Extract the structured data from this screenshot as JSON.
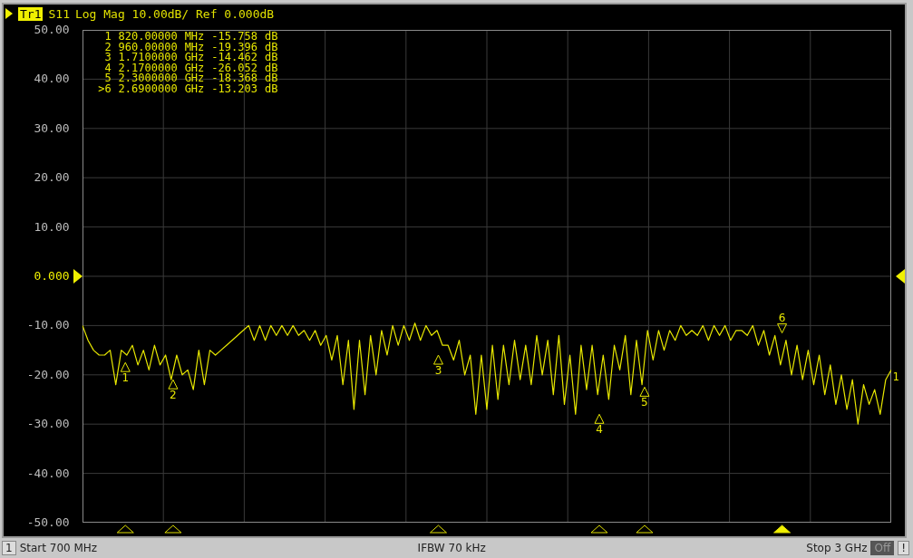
{
  "trace": {
    "tag": "Tr1",
    "title": "Log Mag 10.00dB/ Ref 0.000dB",
    "end_label": "1"
  },
  "plot": {
    "y_ticks": [
      {
        "reference": false
      },
      {
        "reference": false
      },
      {
        "reference": false
      },
      {
        "reference": false
      },
      {
        "reference": false
      },
      {
        "reference": true
      },
      {
        "reference": false
      },
      {
        "reference": false
      },
      {
        "reference": false
      },
      {
        "reference": false
      },
      {
        "reference": false
      }
    ],
    "chart_data": {
      "type": "line",
      "ylim": [
        -50,
        50
      ],
      "yticks": [
        {
          "value": 50,
          "label": "50.00"
        },
        {
          "value": 40,
          "label": "40.00"
        },
        {
          "value": 30,
          "label": "30.00"
        },
        {
          "value": 20,
          "label": "20.00"
        },
        {
          "value": 10,
          "label": "10.00"
        },
        {
          "value": 0,
          "label": "0.000"
        },
        {
          "value": -10,
          "label": "-10.00"
        },
        {
          "value": -20,
          "label": "-20.00"
        },
        {
          "value": -30,
          "label": "-30.00"
        },
        {
          "value": -40,
          "label": "-40.00"
        },
        {
          "value": -50,
          "label": "-50.00"
        }
      ],
      "grid": true,
      "series": [
        {
          "name": "S11",
          "color": "#e8e800",
          "values": [
            -10,
            -13,
            -15,
            -16,
            -16,
            -15,
            -22,
            -15,
            -16,
            -14,
            -18,
            -15,
            -19,
            -14,
            -18,
            -16,
            -21,
            -16,
            -20,
            -19,
            -23,
            -15,
            -22,
            -15,
            -16,
            -15,
            -14,
            -13,
            -12,
            -11,
            -10,
            -13,
            -10,
            -13,
            -10,
            -12,
            -10,
            -12,
            -10,
            -12,
            -11,
            -13,
            -11,
            -14,
            -12,
            -17,
            -12,
            -22,
            -13,
            -27,
            -13,
            -24,
            -12,
            -20,
            -11,
            -16,
            -10,
            -14,
            -10,
            -13,
            -9.5,
            -13,
            -10,
            -12,
            -11,
            -14,
            -14,
            -17,
            -13,
            -20,
            -16,
            -28,
            -16,
            -27,
            -14,
            -25,
            -14,
            -22,
            -13,
            -21,
            -14,
            -22,
            -12,
            -20,
            -13,
            -24,
            -12,
            -26,
            -16,
            -28,
            -14,
            -23,
            -14,
            -24,
            -16,
            -25,
            -14,
            -19,
            -12,
            -24,
            -13,
            -22,
            -11,
            -17,
            -11,
            -15,
            -11,
            -13,
            -10,
            -12,
            -11,
            -12,
            -10,
            -13,
            -10,
            -12,
            -10,
            -13,
            -11,
            -11,
            -12,
            -10,
            -14,
            -11,
            -16,
            -12,
            -18,
            -13,
            -20,
            -14,
            -21,
            -15,
            -22,
            -16,
            -24,
            -18,
            -26,
            -20,
            -27,
            -21,
            -30,
            -22,
            -26,
            -23,
            -28,
            -21,
            -19
          ]
        }
      ]
    }
  },
  "readout": [
    {
      "marker": "1",
      "frequency": "820.00000",
      "unit": "MHz",
      "value": "-15.758",
      "value_unit": "dB"
    },
    {
      "marker": "2",
      "frequency": "960.00000",
      "unit": "MHz",
      "value": "-19.396",
      "value_unit": "dB"
    },
    {
      "marker": "3",
      "frequency": "1.7100000",
      "unit": "GHz",
      "value": "-14.462",
      "value_unit": "dB"
    },
    {
      "marker": "4",
      "frequency": "2.1700000",
      "unit": "GHz",
      "value": "-26.052",
      "value_unit": "dB"
    },
    {
      "marker": "5",
      "frequency": "2.3000000",
      "unit": "GHz",
      "value": "-18.368",
      "value_unit": "dB"
    },
    {
      "marker": ">6",
      "frequency": "2.6900000",
      "unit": "GHz",
      "value": "-13.203",
      "value_unit": "dB"
    }
  ],
  "markers": [
    {
      "label": "1",
      "selected": false
    },
    {
      "label": "2",
      "selected": false
    },
    {
      "label": "3",
      "selected": false
    },
    {
      "label": "4",
      "selected": false
    },
    {
      "label": "5",
      "selected": false
    },
    {
      "label": "6",
      "selected": true
    }
  ],
  "status_bar": {
    "channel": "1",
    "start": "Start 700 MHz",
    "ifbw": "IFBW 70 kHz",
    "stop": "Stop 3 GHz",
    "toggle": "Off",
    "warning": "!"
  }
}
